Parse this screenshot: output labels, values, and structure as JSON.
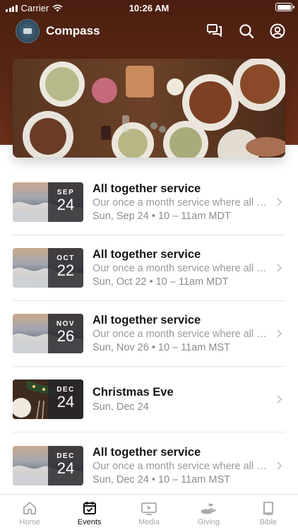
{
  "status_bar": {
    "carrier": "Carrier",
    "time": "10:26 AM"
  },
  "header": {
    "title": "Compass",
    "icons": [
      "chat-icon",
      "search-icon",
      "profile-icon"
    ]
  },
  "colors": {
    "header_bg": "#5b2716",
    "active_tab": "#111111",
    "inactive_tab": "#a8a8a8"
  },
  "events": [
    {
      "month": "SEP",
      "day": "24",
      "title": "All together service",
      "description": "Our once a month service where all h...",
      "when": "Sun, Sep 24 • 10 – 11am MDT"
    },
    {
      "month": "OCT",
      "day": "22",
      "title": "All together service",
      "description": "Our once a month service where all h...",
      "when": "Sun, Oct 22 • 10 – 11am MDT"
    },
    {
      "month": "NOV",
      "day": "26",
      "title": "All together service",
      "description": "Our once a month service where all h...",
      "when": "Sun, Nov 26 • 10 – 11am MST"
    },
    {
      "month": "DEC",
      "day": "24",
      "title": "Christmas Eve",
      "description": "",
      "when": "Sun, Dec 24"
    },
    {
      "month": "DEC",
      "day": "24",
      "title": "All together service",
      "description": "Our once a month service where all h...",
      "when": "Sun, Dec 24 • 10 – 11am MST"
    }
  ],
  "tabs": [
    {
      "label": "Home",
      "icon": "home-icon"
    },
    {
      "label": "Events",
      "icon": "calendar-icon",
      "active": true
    },
    {
      "label": "Media",
      "icon": "media-icon"
    },
    {
      "label": "Giving",
      "icon": "giving-icon"
    },
    {
      "label": "Bible",
      "icon": "bible-icon"
    }
  ]
}
